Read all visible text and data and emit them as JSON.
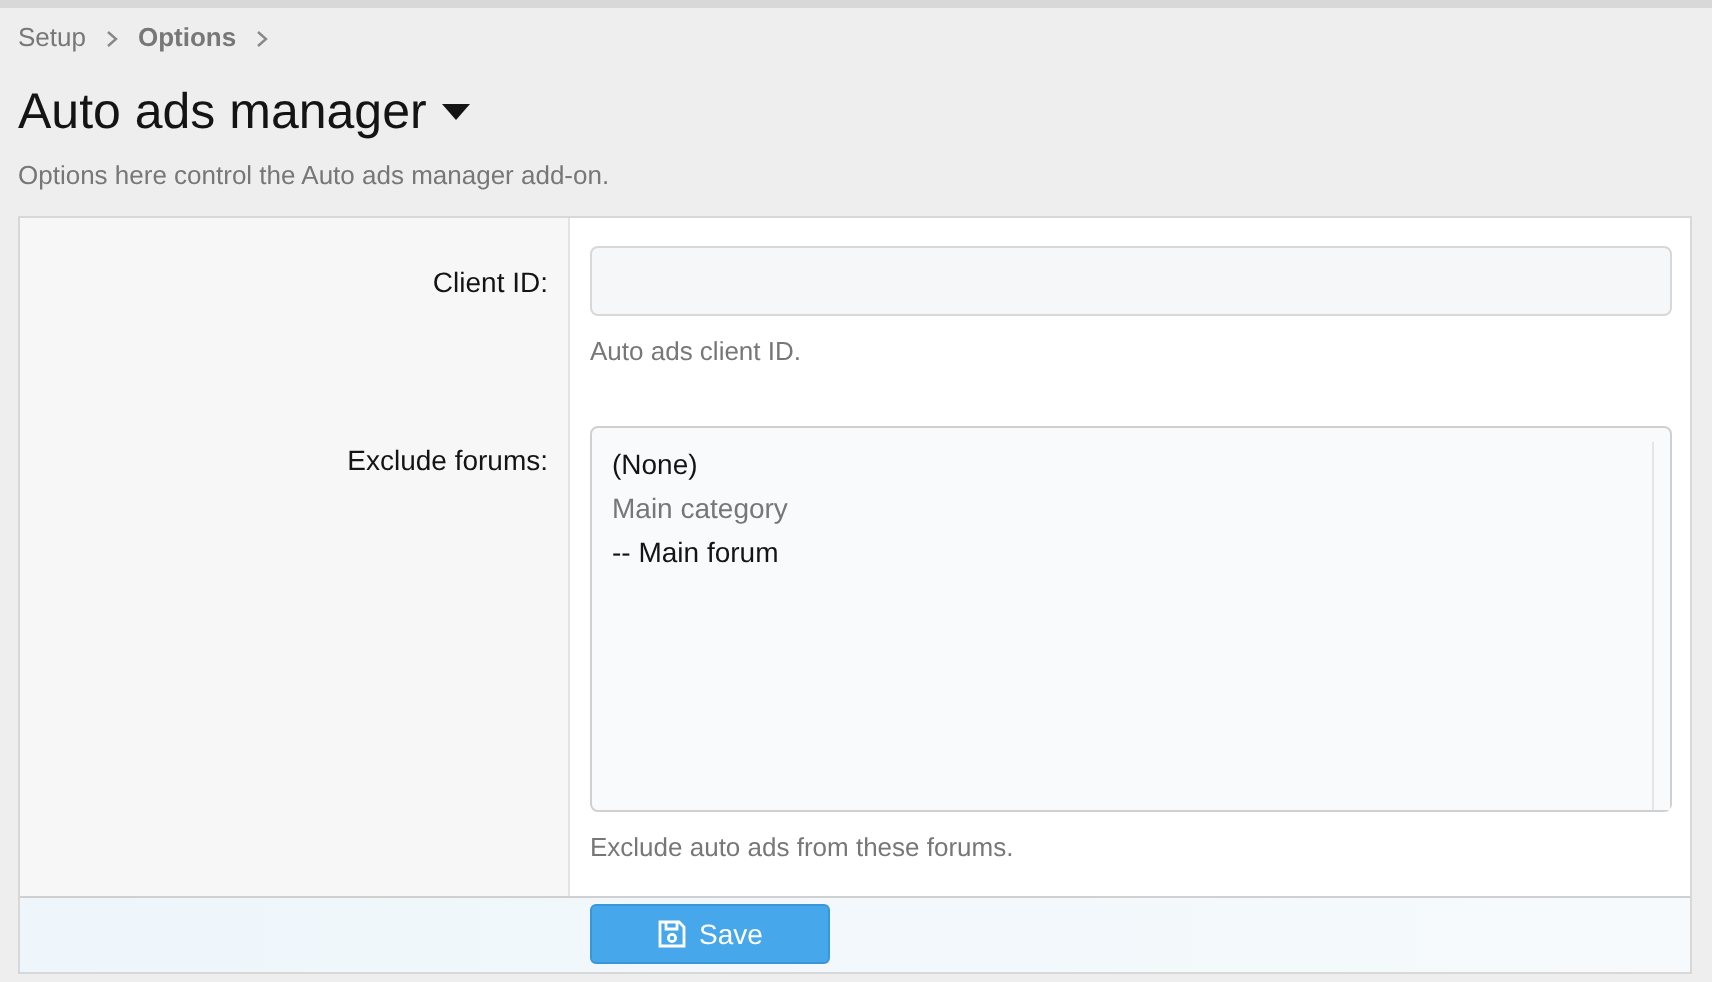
{
  "breadcrumb": [
    "Setup",
    "Options"
  ],
  "title": "Auto ads manager",
  "description": "Options here control the Auto ads manager add-on.",
  "fields": [
    {
      "kind": "text",
      "label": "Client ID:",
      "hint": "Auto ads client ID."
    },
    {
      "kind": "listbox",
      "label": "Exclude forums:",
      "hint": "Exclude auto ads from these forums.",
      "options": [
        {
          "label": "(None)",
          "disabled": false
        },
        {
          "label": "Main category",
          "disabled": true
        },
        {
          "label": "-- Main forum",
          "disabled": false
        }
      ]
    }
  ],
  "save_button": "Save"
}
